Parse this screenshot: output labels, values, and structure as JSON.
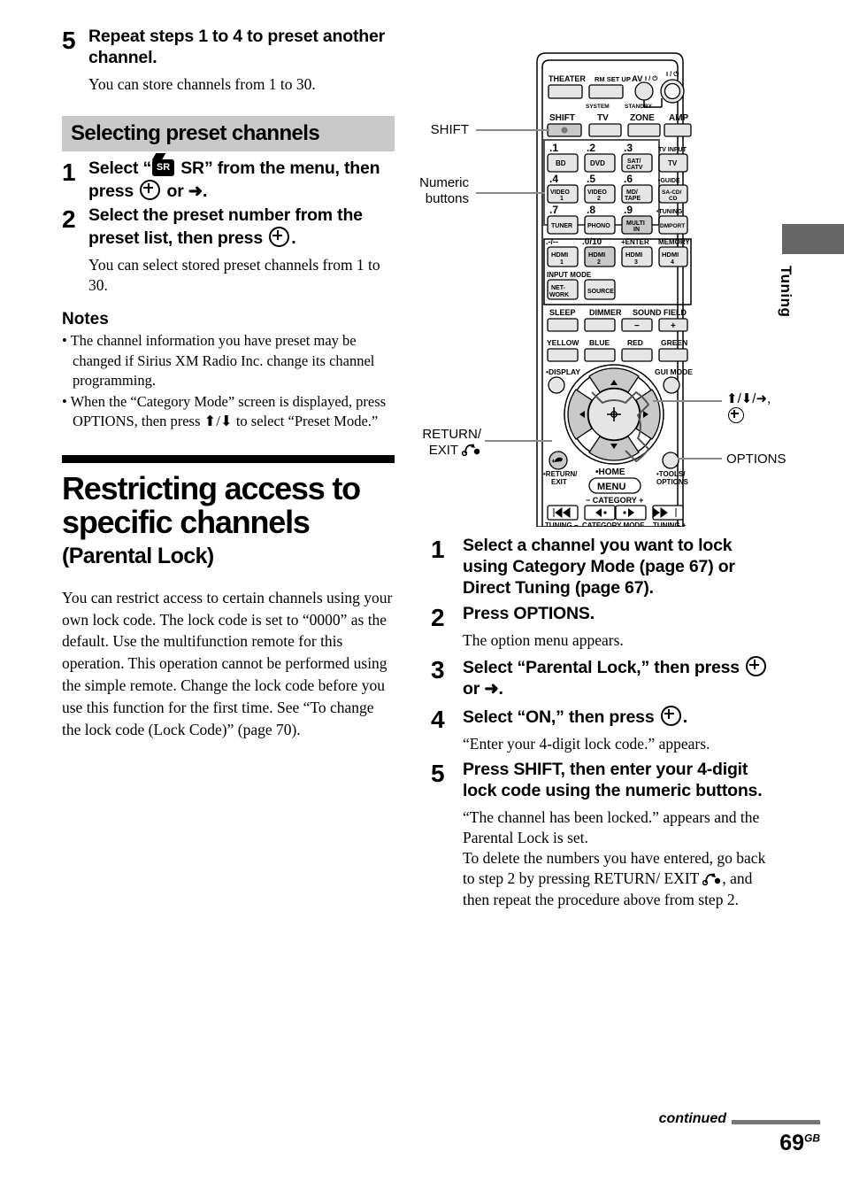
{
  "left_column": {
    "step5_top": {
      "number": "5",
      "title": "Repeat steps 1 to 4 to preset another channel.",
      "desc": "You can store channels from 1 to 30."
    },
    "section_heading": "Selecting preset channels",
    "step1": {
      "number": "1",
      "title_a": "Select “",
      "title_b": " SR” from the menu, then press ",
      "title_c": " or ➜."
    },
    "step2": {
      "number": "2",
      "title_a": "Select the preset number from the preset list, then press ",
      "title_b": ".",
      "desc": "You can select stored preset channels from 1 to 30."
    },
    "notes_heading": "Notes",
    "notes": [
      "• The channel information you have preset may be changed if Sirius XM Radio Inc. change its channel programming.",
      "• When the “Category Mode” screen is displayed, press OPTIONS, then press ⬆/⬇ to select “Preset Mode.”"
    ],
    "chapter_title": "Restricting access to specific channels",
    "chapter_subtitle": "(Parental Lock)",
    "body_paragraph": "You can restrict access to certain channels using your own lock code. The lock code is set to “0000” as the default. Use the multifunction remote for this operation. This operation cannot be performed using the simple remote. Change the lock code before you use this function for the first time. See “To change the lock code (Lock Code)” (page 70)."
  },
  "right_column": {
    "step1": {
      "number": "1",
      "title": "Select a channel you want to lock using Category Mode (page 67) or Direct Tuning (page 67)."
    },
    "step2": {
      "number": "2",
      "title": "Press OPTIONS.",
      "desc": "The option menu appears."
    },
    "step3": {
      "number": "3",
      "title_a": "Select “Parental Lock,” then press ",
      "title_b": " or ➜."
    },
    "step4": {
      "number": "4",
      "title_a": "Select “ON,” then press ",
      "title_b": ".",
      "desc": "“Enter your 4-digit lock code.” appears."
    },
    "step5": {
      "number": "5",
      "title": "Press SHIFT, then enter your 4-digit lock code using the numeric buttons.",
      "desc1": "“The channel has been locked.” appears and the Parental Lock is set.",
      "desc2_a": "To delete the numbers you have entered, go back to step 2 by pressing RETURN/ EXIT ",
      "desc2_b": ", and then repeat the procedure above from step 2."
    }
  },
  "remote": {
    "callouts": {
      "shift": "SHIFT",
      "numeric_line1": "Numeric",
      "numeric_line2": "buttons",
      "return_line1": "RETURN/",
      "return_line2": "EXIT",
      "cursor_line1": "⬆/⬇/➜,",
      "options": "OPTIONS"
    },
    "top_labels": {
      "theater": "THEATER",
      "rm_setup": "RM SET UP",
      "av": "AV",
      "av_power": "I / ⏻",
      "main_power": "I / ⏻",
      "system_standby": "SYSTEM STANDBY"
    },
    "mode_row": [
      "SHIFT",
      "TV",
      "ZONE",
      "AMP"
    ],
    "numeric_grid": [
      {
        "num": ".1",
        "label": "BD"
      },
      {
        "num": ".2",
        "label": "DVD"
      },
      {
        "num": ".3",
        "label": "SAT/ CATV"
      },
      {
        "num": ".4",
        "label": "VIDEO 1"
      },
      {
        "num": ".5",
        "label": "VIDEO 2"
      },
      {
        "num": ".6",
        "label": "MD/ TAPE"
      },
      {
        "num": ".7",
        "label": "TUNER"
      },
      {
        "num": ".8",
        "label": "PHONO"
      },
      {
        "num": ".9",
        "label": "MULTI IN"
      }
    ],
    "right_column_buttons": [
      {
        "num": "TV INPUT",
        "label": "TV"
      },
      {
        "num": "•GUIDE",
        "label": "SA-CD/ CD"
      },
      {
        "num": "•TUNING",
        "label": "DMPORT"
      },
      {
        "num": "MEMORY",
        "label": "HDMI 4"
      }
    ],
    "hdmi_row_labels": [
      ".-/--",
      ".0/10",
      "+ENTER",
      "MEMORY"
    ],
    "hdmi_buttons": [
      "HDMI 1",
      "HDMI 2",
      "HDMI 3",
      "HDMI 4"
    ],
    "input_mode": "INPUT MODE",
    "network": "NET- WORK",
    "source": "SOURCE",
    "func_row": [
      "SLEEP",
      "DIMMER",
      "SOUND FIELD"
    ],
    "sound_field_minus": "−",
    "sound_field_plus": "+",
    "color_row": [
      "YELLOW",
      "BLUE",
      "RED",
      "GREEN"
    ],
    "display": "•DISPLAY",
    "gui_mode": "GUI MODE",
    "home": "•HOME",
    "menu": "MENU",
    "return_exit_l1": "•RETURN/",
    "return_exit_l2": "EXIT",
    "tools_options_l1": "•TOOLS/",
    "tools_options_l2": "OPTIONS",
    "category": "− CATEGORY +",
    "tuning_minus": "TUNING −",
    "category_mode": "CATEGORY MODE",
    "tuning_plus": "TUNING +"
  },
  "side_tab": {
    "label": "Tuning"
  },
  "footer": {
    "continued": "continued",
    "page": "69",
    "page_sup": "GB"
  }
}
